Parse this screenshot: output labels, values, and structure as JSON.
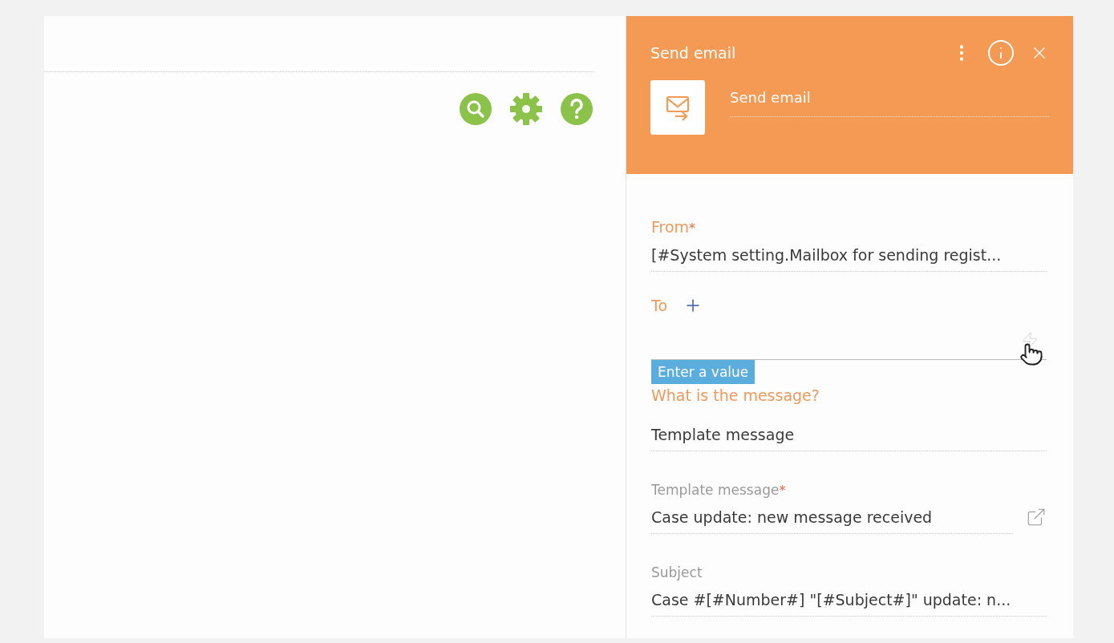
{
  "toolbar": {
    "buttons": [
      {
        "kind": "search"
      },
      {
        "kind": "settings"
      },
      {
        "kind": "help"
      }
    ]
  },
  "panel": {
    "title": "Send email",
    "element_name": "Send email",
    "fields": [
      {
        "kind": "value",
        "label": "From",
        "highlighted": true,
        "required_mark": "*",
        "value": "[#System setting.Mailbox for sending regist..."
      },
      {
        "kind": "recipients",
        "label": "To",
        "highlighted": true,
        "tooltip": "Enter a value"
      },
      {
        "kind": "value",
        "label": "What is the message?",
        "highlighted": true,
        "value": "Template message"
      },
      {
        "kind": "value",
        "label": "Template message",
        "highlighted": false,
        "required_mark": "*",
        "value": "Case update: new message received",
        "has_link": true
      },
      {
        "kind": "value",
        "label": "Subject",
        "highlighted": false,
        "value": "Case #[#Number#] \"[#Subject#]\" update: n..."
      }
    ]
  }
}
